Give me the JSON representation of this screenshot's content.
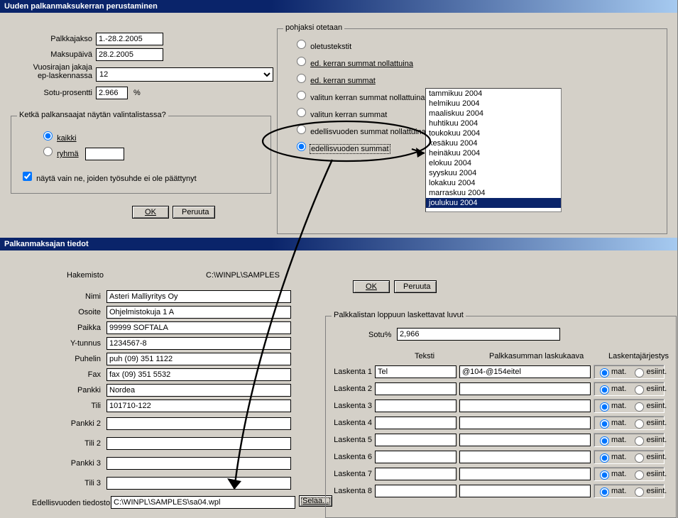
{
  "top": {
    "title": "Uuden palkanmaksukerran perustaminen",
    "labels": {
      "palkkajakso": "Palkkajakso",
      "maksupaiva": "Maksupäivä",
      "vuosirajan": "Vuosirajan jakaja\nep-laskennassa",
      "sotu": "Sotu-prosentti",
      "percent": "%"
    },
    "values": {
      "palkkajakso": "1.-28.2.2005",
      "maksupaiva": "28.2.2005",
      "vuosirajan": "12",
      "sotu": "2.966"
    },
    "ketka": {
      "title": "Ketkä palkansaajat näytän valintalistassa?",
      "kaikki": "kaikki",
      "ryhma": "ryhmä",
      "nayta": "näytä vain ne, joiden työsuhde ei ole päättynyt"
    },
    "pohjaksi": {
      "title": "pohjaksi otetaan",
      "options": [
        "oletustekstit",
        "ed. kerran summat nollattuina",
        "ed. kerran summat",
        "valitun kerran summat nollattuina",
        "valitun kerran summat",
        "edellisvuoden summat nollattuina",
        "edellisvuoden summat"
      ],
      "months": [
        "tammikuu 2004",
        "helmikuu 2004",
        "maaliskuu 2004",
        "huhtikuu 2004",
        "toukokuu 2004",
        "kesäkuu 2004",
        "heinäkuu 2004",
        "elokuu 2004",
        "syyskuu 2004",
        "lokakuu 2004",
        "marraskuu 2004",
        "joulukuu 2004"
      ]
    },
    "buttons": {
      "ok": "OK",
      "peruuta": "Peruuta"
    }
  },
  "bottom": {
    "title": "Palkanmaksajan tiedot",
    "labels": {
      "hakemisto": "Hakemisto",
      "hakemisto_value": "C:\\WINPL\\SAMPLES",
      "nimi": "Nimi",
      "osoite": "Osoite",
      "paikka": "Paikka",
      "ytunnus": "Y-tunnus",
      "puhelin": "Puhelin",
      "fax": "Fax",
      "pankki": "Pankki",
      "tili": "Tili",
      "pankki2": "Pankki 2",
      "tili2": "Tili 2",
      "pankki3": "Pankki 3",
      "tili3": "Tili 3",
      "edellisvuoden": "Edellisvuoden tiedosto",
      "selaa": "Selaa..."
    },
    "values": {
      "nimi": "Asteri Malliyritys Oy",
      "osoite": "Ohjelmistokuja 1 A",
      "paikka": "99999 SOFTALA",
      "ytunnus": "1234567-8",
      "puhelin": "puh (09) 351 1122",
      "fax": "fax (09) 351 5532",
      "pankki": "Nordea",
      "tili": "101710-122",
      "pankki2": "",
      "tili2": "",
      "pankki3": "",
      "tili3": "",
      "edellisvuoden": "C:\\WINPL\\SAMPLES\\sa04.wpl"
    },
    "buttons": {
      "ok": "OK",
      "peruuta": "Peruuta"
    },
    "palkkalista": {
      "title": "Palkkalistan loppuun laskettavat luvut",
      "sotu_label": "Sotu%",
      "sotu_value": "2,966",
      "cols": {
        "teksti": "Teksti",
        "kaava": "Palkkasumman laskukaava",
        "jarj": "Laskentajärjestys"
      },
      "order": {
        "mat": "mat.",
        "esiint": "esiint."
      },
      "rows": [
        {
          "label": "Laskenta 1",
          "teksti": "Tel",
          "kaava": "@104-@154eitel"
        },
        {
          "label": "Laskenta 2",
          "teksti": "",
          "kaava": ""
        },
        {
          "label": "Laskenta 3",
          "teksti": "",
          "kaava": ""
        },
        {
          "label": "Laskenta 4",
          "teksti": "",
          "kaava": ""
        },
        {
          "label": "Laskenta 5",
          "teksti": "",
          "kaava": ""
        },
        {
          "label": "Laskenta 6",
          "teksti": "",
          "kaava": ""
        },
        {
          "label": "Laskenta 7",
          "teksti": "",
          "kaava": ""
        },
        {
          "label": "Laskenta 8",
          "teksti": "",
          "kaava": ""
        }
      ]
    }
  }
}
